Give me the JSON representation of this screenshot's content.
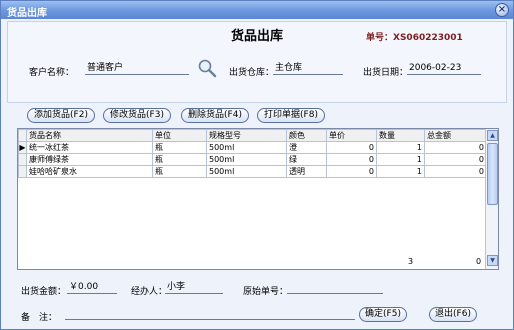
{
  "window": {
    "title": "货品出库",
    "close_glyph": "×"
  },
  "form": {
    "title": "货品出库",
    "doc_number_label": "单号：",
    "doc_number": "XS060223001",
    "customer_label": "客户名称：",
    "customer_value": "普通客户",
    "warehouse_label": "出货仓库：",
    "warehouse_value": "主仓库",
    "date_label": "出货日期：",
    "date_value": "2006-02-23",
    "search_icon": "magnifier-icon"
  },
  "toolbar": {
    "add": "添加货品(F2)",
    "edit": "修改货品(F3)",
    "delete": "删除货品(F4)",
    "print": "打印单据(F8)"
  },
  "grid": {
    "columns": [
      "货品名称",
      "单位",
      "规格型号",
      "颜色",
      "单价",
      "数量",
      "总金额"
    ],
    "rows": [
      {
        "indicator": "▶",
        "name": "统一冰红茶",
        "unit": "瓶",
        "spec": "500ml",
        "color": "澄",
        "price": "0",
        "qty": "1",
        "amount": "0"
      },
      {
        "indicator": "",
        "name": "康师傅绿茶",
        "unit": "瓶",
        "spec": "500ml",
        "color": "绿",
        "price": "0",
        "qty": "1",
        "amount": "0"
      },
      {
        "indicator": "",
        "name": "娃哈哈矿泉水",
        "unit": "瓶",
        "spec": "500ml",
        "color": "透明",
        "price": "0",
        "qty": "1",
        "amount": "0"
      }
    ],
    "totals": {
      "qty": "3",
      "amount": "0"
    }
  },
  "footer": {
    "amount_label": "出货金额：",
    "amount_value": "￥0.00",
    "handler_label": "经办人：",
    "handler_value": "小李",
    "orig_label": "原始单号：",
    "orig_value": "",
    "remark_label": "备　注：",
    "remark_value": "",
    "ok": "确定(F5)",
    "exit": "退出(F6)"
  }
}
